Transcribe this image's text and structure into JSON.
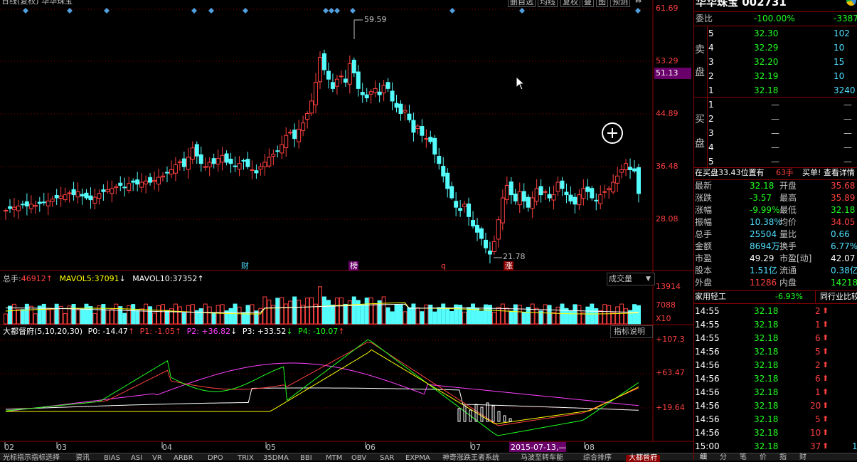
{
  "window": {
    "title_left": "日线(复权) 华华珠宝",
    "toolbar": [
      "删自选",
      "均线",
      "复权",
      "叠",
      "图",
      "预测"
    ]
  },
  "stock": {
    "name_code": "华华珠宝 002731"
  },
  "price_axis": [
    "61.69",
    "53.29",
    "51.13",
    "44.89",
    "36.48",
    "28.08"
  ],
  "annotations": {
    "high": "59.59",
    "low": "21.78",
    "events": [
      "财",
      "榜",
      "q",
      "涨"
    ]
  },
  "volume_panel": {
    "total_label": "总手:",
    "total_value": "46912",
    "mavol5_label": "MAVOL5:",
    "mavol5_value": "37091",
    "mavol10_label": "MAVOL10:",
    "mavol10_value": "37352",
    "dropdown": "成交量",
    "axis": [
      "13914",
      "7088",
      "X10"
    ]
  },
  "indicator_panel": {
    "name": "大都督府(5,10,20,30)",
    "p0": "P0: -14.47",
    "p1": "P1: -1.05",
    "p2": "P2: +36.82",
    "p3": "P3: +33.52",
    "p4": "P4: -10.07",
    "help": "指标说明",
    "axis": [
      "+107.3",
      "+63.47",
      "+19.64"
    ]
  },
  "x_axis": {
    "months": [
      "02",
      "03",
      "04",
      "05",
      "06",
      "07",
      "08"
    ],
    "cursor_date": "2015-07-13,—"
  },
  "bottom_tabs": [
    "光标指示",
    "指标选择",
    "资讯",
    "BIAS",
    "ASI",
    "VR",
    "ARBR",
    "DPO",
    "TRIX",
    "35DMA",
    "BBI",
    "MTM",
    "OBV",
    "SAR",
    "EXPMA",
    "神奇涨跌王者系统",
    "马波至转车能",
    "综合排序",
    "大都督府"
  ],
  "right_panel": {
    "weibi_label": "委比",
    "weibi_value": "-100.00%",
    "weicha_value": "-3387",
    "sell_label": [
      "卖",
      "盘"
    ],
    "buy_label": [
      "买",
      "盘"
    ],
    "sell_orders": [
      {
        "level": "5",
        "price": "32.30",
        "vol": "102"
      },
      {
        "level": "4",
        "price": "32.29",
        "vol": "10"
      },
      {
        "level": "3",
        "price": "32.20",
        "vol": "15"
      },
      {
        "level": "2",
        "price": "32.19",
        "vol": "10"
      },
      {
        "level": "1",
        "price": "32.18",
        "vol": "3240"
      }
    ],
    "buy_orders": [
      {
        "level": "1",
        "price": "—",
        "vol": "—"
      },
      {
        "level": "2",
        "price": "—",
        "vol": "—"
      },
      {
        "level": "3",
        "price": "—",
        "vol": "—"
      },
      {
        "level": "4",
        "price": "—",
        "vol": "—"
      },
      {
        "level": "5",
        "price": "—",
        "vol": "—"
      }
    ],
    "position_text": "在买盘33.43位置有",
    "position_count": "63手",
    "position_action": "买单! 查看详情",
    "stats": [
      {
        "l1": "最新",
        "v1": "32.18",
        "l2": "开盘",
        "v2": "35.68"
      },
      {
        "l1": "涨跌",
        "v1": "-3.57",
        "l2": "最高",
        "v2": "35.89"
      },
      {
        "l1": "涨幅",
        "v1": "-9.99%",
        "l2": "最低",
        "v2": "32.18"
      },
      {
        "l1": "振幅",
        "v1": "10.38%",
        "l2": "均价",
        "v2": "34.05"
      },
      {
        "l1": "总手",
        "v1": "25504",
        "l2": "量比",
        "v2": "0.66"
      },
      {
        "l1": "金额",
        "v1": "8694万",
        "l2": "换手",
        "v2": "6.77%"
      },
      {
        "l1": "市盈",
        "v1": "49.29",
        "l2": "市盈[动]",
        "v2": "42.07"
      },
      {
        "l1": "股本",
        "v1": "1.51亿",
        "l2": "流通",
        "v2": "0.38亿"
      },
      {
        "l1": "外盘",
        "v1": "11286",
        "l2": "内盘",
        "v2": "14218"
      }
    ],
    "industry_label": "家用轻工",
    "industry_change": "-6.93%",
    "industry_button": "同行业比较",
    "trades": [
      {
        "time": "14:55",
        "price": "32.18",
        "vol": "2"
      },
      {
        "time": "14:55",
        "price": "32.18",
        "vol": "1"
      },
      {
        "time": "14:55",
        "price": "32.18",
        "vol": "6"
      },
      {
        "time": "14:56",
        "price": "32.18",
        "vol": "5"
      },
      {
        "time": "14:56",
        "price": "32.18",
        "vol": "2"
      },
      {
        "time": "14:56",
        "price": "32.18",
        "vol": "6"
      },
      {
        "time": "14:56",
        "price": "32.18",
        "vol": "1"
      },
      {
        "time": "14:56",
        "price": "32.18",
        "vol": "20"
      },
      {
        "time": "14:56",
        "price": "32.18",
        "vol": "5"
      },
      {
        "time": "14:56",
        "price": "32.18",
        "vol": "10"
      },
      {
        "time": "15:00",
        "price": "32.18",
        "vol": "37"
      }
    ],
    "trade_tail": "1",
    "bottom_tabs": [
      "细",
      "分",
      "笔",
      "价",
      "指",
      "财"
    ]
  },
  "colors": {
    "up": "#ff4040",
    "down": "#54fcfc",
    "grid": "#8b0000",
    "ma_white": "#ffffff",
    "ma_yellow": "#ffff00",
    "ma_magenta": "#ff40ff",
    "ma_green": "#20ff20"
  }
}
